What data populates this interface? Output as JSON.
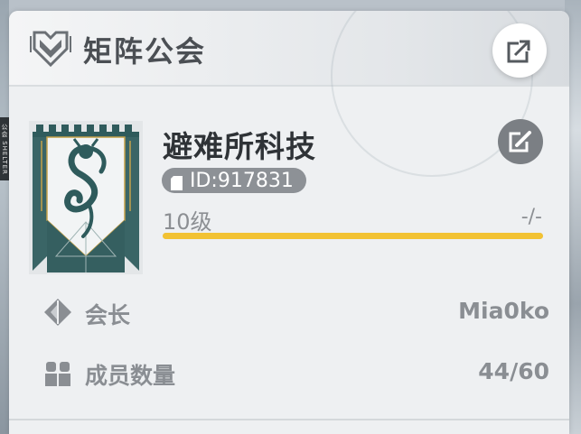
{
  "header": {
    "title": "矩阵公会",
    "guild_icon": "shield-emblem-icon",
    "share_icon": "share-export-icon"
  },
  "side_tab": {
    "label": "公会 SHELTER"
  },
  "guild": {
    "name": "避难所科技",
    "id_text": "ID:917831",
    "id_icon": "copy-document-icon",
    "edit_icon": "edit-pencil-icon",
    "level_label": "10级",
    "exp_label": "-/-",
    "progress_fraction": 1.0,
    "banner_icon": "serpent-banner-icon"
  },
  "stats": [
    {
      "label": "会长",
      "value": "Mia0ko",
      "icon": "leader-diamond-icon"
    },
    {
      "label": "成员数量",
      "value": "44/60",
      "icon": "members-icon"
    }
  ],
  "colors": {
    "accent_progress": "#f2c233",
    "banner_teal": "#2f5b5c",
    "text_muted": "#8a8e93",
    "title_dark": "#2f3337"
  }
}
